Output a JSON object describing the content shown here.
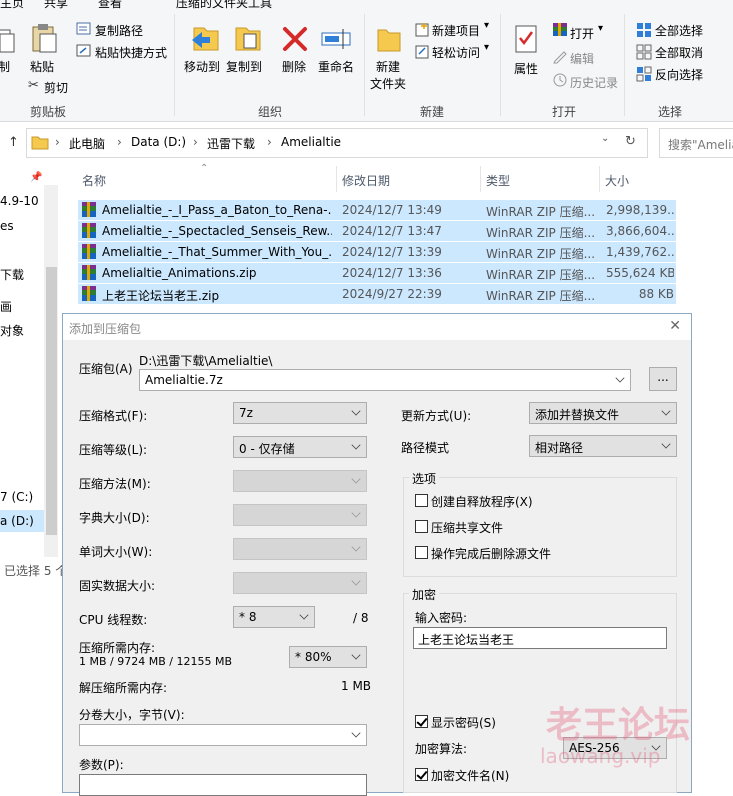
{
  "ribbon": {
    "tabs": {
      "home": "主页",
      "share": "共享",
      "view": "查看",
      "tools": "压缩的文件夹工具"
    },
    "clipboard": {
      "cut_partial": "制",
      "paste": "粘贴",
      "copy_path": "复制路径",
      "paste_shortcut": "粘贴快捷方式",
      "cut": "剪切",
      "group": "剪贴板"
    },
    "organize": {
      "move_to": "移动到",
      "copy_to": "复制到",
      "delete": "删除",
      "rename": "重命名",
      "group": "组织"
    },
    "new": {
      "new_folder_line1": "新建",
      "new_folder_line2": "文件夹",
      "new_item": "新建项目",
      "easy_access": "轻松访问",
      "group": "新建"
    },
    "open": {
      "properties": "属性",
      "open": "打开",
      "edit": "编辑",
      "history": "历史记录",
      "group": "打开"
    },
    "select": {
      "select_all": "全部选择",
      "select_none": "全部取消",
      "invert": "反向选择",
      "group": "选择"
    }
  },
  "address": {
    "crumbs": [
      "此电脑",
      "Data (D:)",
      "迅雷下载",
      "Amelialtie"
    ],
    "search_placeholder": "搜索\"Amelialtie\""
  },
  "columns": {
    "name": "名称",
    "modified": "修改日期",
    "type": "类型",
    "size": "大小"
  },
  "files": [
    {
      "name": "Amelialtie_-_I_Pass_a_Baton_to_Rena-...",
      "modified": "2024/12/7 13:49",
      "type": "WinRAR ZIP 压缩...",
      "size": "2,998,139..."
    },
    {
      "name": "Amelialtie_-_Spectacled_Senseis_Rew...",
      "modified": "2024/12/7 13:47",
      "type": "WinRAR ZIP 压缩...",
      "size": "3,866,604..."
    },
    {
      "name": "Amelialtie_-_That_Summer_With_You_...",
      "modified": "2024/12/7 13:39",
      "type": "WinRAR ZIP 压缩...",
      "size": "1,439,762..."
    },
    {
      "name": "Amelialtie_Animations.zip",
      "modified": "2024/12/7 13:36",
      "type": "WinRAR ZIP 压缩...",
      "size": "555,624 KB"
    },
    {
      "name": "上老王论坛当老王.zip",
      "modified": "2024/9/27 22:39",
      "type": "WinRAR ZIP 压缩...",
      "size": "88 KB"
    }
  ],
  "nav": {
    "item1": "4.9-10",
    "item2": "es",
    "item3": "下载",
    "item4": "画",
    "item5": "对象",
    "drive_c": "7 (C:)",
    "drive_d": "a (D:)",
    "status": "已选择 5 个"
  },
  "dialog": {
    "title": "添加到压缩包",
    "archive_label": "压缩包(A)",
    "archive_path": "D:\\迅雷下载\\Amelialtie\\",
    "archive_name": "Amelialtie.7z",
    "browse": "...",
    "format_label": "压缩格式(F):",
    "format_value": "7z",
    "level_label": "压缩等级(L):",
    "level_value": "0 - 仅存储",
    "method_label": "压缩方法(M):",
    "dict_label": "字典大小(D):",
    "word_label": "单词大小(W):",
    "solid_label": "固实数据大小:",
    "cpu_label": "CPU 线程数:",
    "cpu_value": "* 8",
    "cpu_max": "/ 8",
    "mem_comp_label": "压缩所需内存:",
    "mem_comp_value": "1 MB / 9724 MB / 12155 MB",
    "mem_pct": "* 80%",
    "mem_decomp_label": "解压缩所需内存:",
    "mem_decomp_value": "1 MB",
    "split_label": "分卷大小，字节(V):",
    "params_label": "参数(P):",
    "update_label": "更新方式(U):",
    "update_value": "添加并替换文件",
    "path_label": "路径模式",
    "path_value": "相对路径",
    "options_title": "选项",
    "opt_sfx": "创建自释放程序(X)",
    "opt_shared": "压缩共享文件",
    "opt_delete": "操作完成后删除源文件",
    "encrypt_title": "加密",
    "password_label": "输入密码:",
    "password_value": "上老王论坛当老王",
    "show_password": "显示密码(S)",
    "enc_method_label": "加密算法:",
    "enc_method_value": "AES-256",
    "encrypt_names": "加密文件名(N)"
  },
  "watermark": {
    "big": "老王论坛",
    "small": "laowang.vip"
  }
}
